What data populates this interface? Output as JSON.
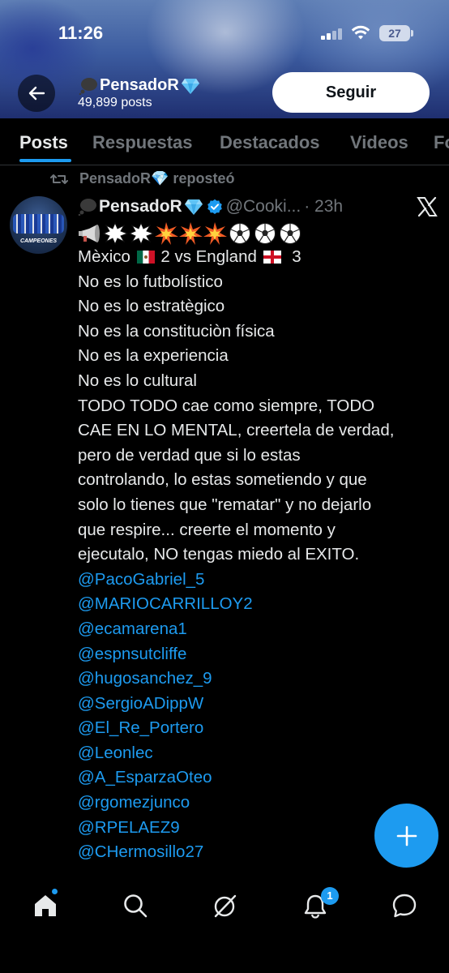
{
  "status_bar": {
    "time": "11:26",
    "battery": "27"
  },
  "profile": {
    "name": "PensadoR",
    "posts_count": "49,899 posts",
    "follow_label": "Seguir"
  },
  "tabs": [
    "Posts",
    "Respuestas",
    "Destacados",
    "Videos",
    "Fo"
  ],
  "repost": {
    "label": "PensadoR💎 reposteó"
  },
  "tweet": {
    "name": "PensadoR",
    "handle": "@Cooki...",
    "time": "· 23h",
    "lines": [
      "No es lo futbolístico",
      "No es lo estratègico",
      "No es la constituciòn física",
      "No es la experiencia",
      "No es lo cultural",
      "TODO TODO cae como siempre, TODO",
      "CAE EN LO MENTAL, creertela de verdad,",
      "pero de verdad que si lo estas",
      "controlando, lo estas sometiendo y que",
      "solo lo tienes que \"rematar\" y no dejarlo",
      "que respire... creerte el momento y",
      "ejecutalo, NO tengas miedo al EXITO."
    ],
    "score": {
      "team1": "Mèxico",
      "score1": "2 vs England",
      "score2": "3"
    },
    "mentions": [
      "@PacoGabriel_5",
      "@MARIOCARRILLOY2",
      "@ecamarena1",
      "@espnsutcliffe",
      "@hugosanchez_9",
      "@SergioADippW",
      "@El_Re_Portero",
      "@Leonlec",
      "@A_EsparzaOteo",
      "@rgomezjunco",
      "@RPELAEZ9",
      "@CHermosillo27"
    ],
    "avatar_text": "CAMPEONES"
  },
  "nav": {
    "notifications_badge": "1"
  },
  "colors": {
    "accent": "#1d9bf0",
    "background": "#000000",
    "muted": "#71767b",
    "text": "#e7e9ea"
  },
  "icons": [
    "back-arrow-icon",
    "thought-balloon-icon",
    "gem-icon",
    "verified-icon",
    "x-logo-icon",
    "megaphone-icon",
    "anger-burst-icon",
    "collision-icon",
    "soccer-ball-icon",
    "mexico-flag-icon",
    "england-flag-icon",
    "plus-icon",
    "home-icon",
    "search-icon",
    "grok-icon",
    "bell-icon",
    "messages-icon",
    "repost-icon"
  ]
}
